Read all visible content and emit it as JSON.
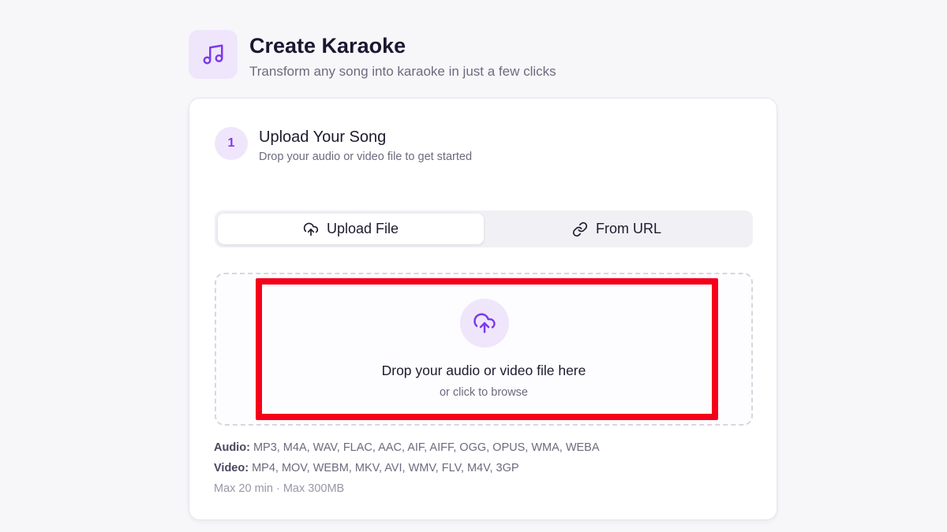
{
  "header": {
    "title": "Create Karaoke",
    "subtitle": "Transform any song into karaoke in just a few clicks",
    "icon": "music-note-icon"
  },
  "step": {
    "number": "1",
    "title": "Upload Your Song",
    "subtitle": "Drop your audio or video file to get started"
  },
  "tabs": [
    {
      "label": "Upload File",
      "icon": "cloud-upload-icon",
      "active": true
    },
    {
      "label": "From URL",
      "icon": "link-icon",
      "active": false
    }
  ],
  "dropzone": {
    "title": "Drop your audio or video file here",
    "subtitle": "or click to browse",
    "icon": "cloud-upload-icon"
  },
  "formats": {
    "audio_label": "Audio:",
    "audio_list": "MP3, M4A, WAV, FLAC, AAC, AIF, AIFF, OGG, OPUS, WMA, WEBA",
    "video_label": "Video:",
    "video_list": "MP4, MOV, WEBM, MKV, AVI, WMV, FLV, M4V, 3GP",
    "limits": "Max 20 min · Max 300MB"
  },
  "colors": {
    "accent": "#7c3aed",
    "accent_light": "#efe6fb",
    "highlight": "#f5001a",
    "background": "#f7f7fa"
  }
}
